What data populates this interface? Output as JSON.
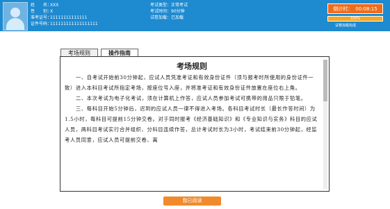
{
  "candidate": {
    "name_label": "姓　　名：",
    "name_value": "XXX",
    "gender_label": "性　　别：",
    "gender_value": "X",
    "ticket_label": "准考证号：",
    "ticket_value": "11111111111111",
    "id_label": "证件号码：",
    "id_value": "111111111111111111"
  },
  "exam": {
    "type_label": "考试类型：",
    "type_value": "正常考试",
    "duration_label": "考试时间：",
    "duration_value": "90分钟",
    "status_label": "试卷加载：",
    "status_value": "已加载"
  },
  "timer": {
    "label": "倒计时：",
    "value": "00:08:15"
  },
  "progress": {
    "percent_text": "100%",
    "percent": 100,
    "caption": "试卷加载完成"
  },
  "tabs": [
    {
      "label": "考场规则",
      "active": false
    },
    {
      "label": "操作指南",
      "active": true
    }
  ],
  "rules": {
    "title": "考场规则",
    "paragraphs": [
      "一、自考试开始前30分钟起，应试人员凭准考证和有效身份证件（须与报考时所使用的身份证件一致）进入本科目考试所指定考场，按座位号入座，并将准考证和有效身份证件放置在座位右上角。",
      "二、本次考试为电子化考试，须在计算机上作答，应试人员参加考试可携带的用品只限于铅笔。",
      "三、每科目开始5分钟后，迟到的应试人员一律不得进入考场。各科目考试时长（最长作答时间）为1.5小时，每科目可提前15分钟交卷。对于同时报考《经济基础知识》和《专业知识与实务》科目的应试人员，两科目考试实行合并组织、分科目连续作答，总计考试时长为3小时，考试结束前30分钟起，经监考人员同意，应试人员可提前交卷、离"
    ]
  },
  "start_button": "我已阅读"
}
